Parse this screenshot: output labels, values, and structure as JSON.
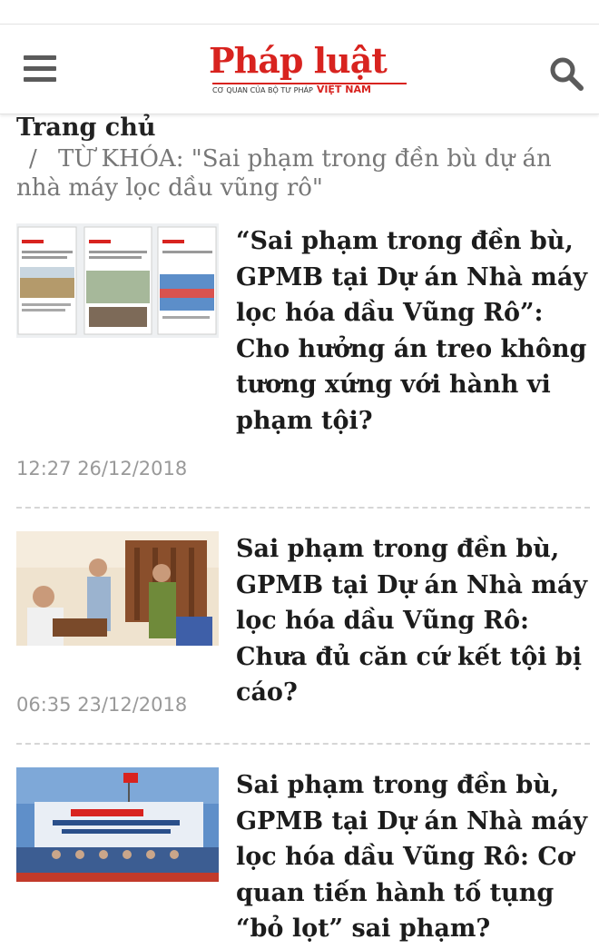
{
  "header": {
    "logo_main": "Pháp luật",
    "logo_tagline": "CƠ QUAN CỦA BỘ TƯ PHÁP",
    "logo_country": "VIỆT NAM"
  },
  "breadcrumb": {
    "home": "Trang chủ",
    "separator": "/",
    "keyword": "TỪ KHÓA: \"Sai phạm trong đền bù dự án nhà máy lọc dầu vũng rô\""
  },
  "articles": [
    {
      "title": "“Sai phạm trong đền bù, GPMB tại Dự án Nhà máy lọc hóa dầu Vũng Rô”: Cho hưởng án treo không tương xứng với hành vi phạm tội?",
      "time": "12:27 26/12/2018"
    },
    {
      "title": "Sai phạm trong đền bù, GPMB tại Dự án Nhà máy lọc hóa dầu Vũng Rô: Chưa đủ căn cứ kết tội bị cáo?",
      "time": "06:35 23/12/2018"
    },
    {
      "title": "Sai phạm trong đền bù, GPMB tại Dự án Nhà máy lọc hóa dầu Vũng Rô: Cơ quan tiến hành tố tụng “bỏ lọt” sai phạm?",
      "time": ""
    }
  ],
  "colors": {
    "brand_red": "#d8231f",
    "icon_gray": "#5b5b5b",
    "meta_gray": "#999999"
  },
  "icons": [
    "menu-icon",
    "search-icon"
  ]
}
